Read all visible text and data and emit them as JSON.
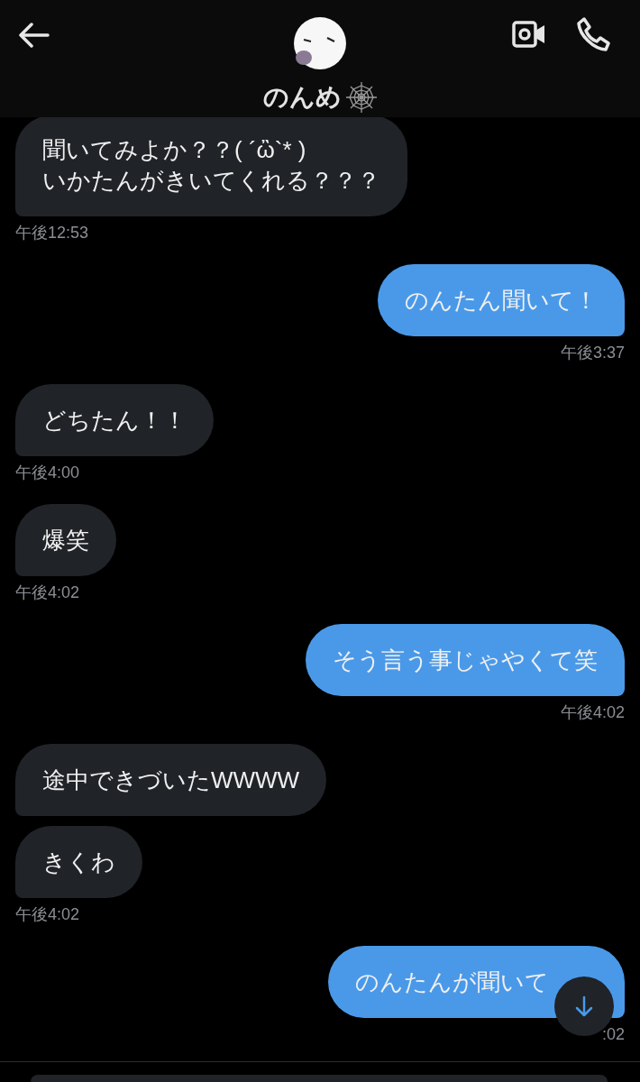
{
  "header": {
    "name": "のんめ"
  },
  "messages": [
    {
      "kind": "incoming",
      "text": "聞いてみよか？？( ´ὢ`* )\nいかたんがきいてくれる？？？",
      "time": "午後12:53"
    },
    {
      "kind": "outgoing",
      "text": "のんたん聞いて！",
      "time": "午後3:37"
    },
    {
      "kind": "incoming",
      "text": "どちたん！！",
      "time": "午後4:00"
    },
    {
      "kind": "incoming",
      "text": "爆笑",
      "time": "午後4:02"
    },
    {
      "kind": "outgoing",
      "text": "そう言う事じゃやくて笑",
      "time": "午後4:02"
    },
    {
      "kind": "incoming",
      "text": "途中できづいたWWWW"
    },
    {
      "kind": "incoming",
      "text": "きくわ",
      "time": "午後4:02"
    },
    {
      "kind": "outgoing",
      "text": "のんたんが聞いて",
      "time": ":02"
    }
  ]
}
